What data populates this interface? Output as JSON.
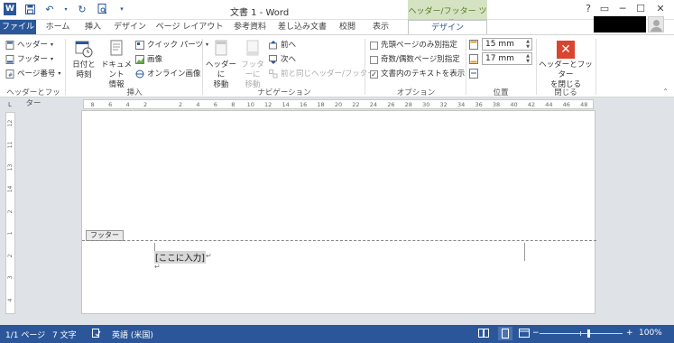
{
  "titlebar": {
    "doc_title": "文書 1 - Word",
    "contextual_tab_group": "ヘッダー/フッター ツール",
    "help_glyph": "?",
    "restore_glyph": "▭",
    "minimize_glyph": "─",
    "maximize_glyph": "☐",
    "close_glyph": "✕",
    "word_logo": "W"
  },
  "tabs": [
    {
      "label": "ファイル"
    },
    {
      "label": "ホーム"
    },
    {
      "label": "挿入"
    },
    {
      "label": "デザイン"
    },
    {
      "label": "ページ レイアウト"
    },
    {
      "label": "参考資料"
    },
    {
      "label": "差し込み文書"
    },
    {
      "label": "校閲"
    },
    {
      "label": "表示"
    },
    {
      "label": "デザイン"
    }
  ],
  "ribbon": {
    "hf_group": {
      "header": "ヘッダー",
      "footer": "フッター",
      "page_number": "ページ番号",
      "label": "ヘッダーとフッター"
    },
    "insert_group": {
      "datetime_l1": "日付と",
      "datetime_l2": "時刻",
      "docinfo_l1": "ドキュメント",
      "docinfo_l2": "情報",
      "quickparts": "クイック パーツ",
      "picture": "画像",
      "online_picture": "オンライン画像",
      "label": "挿入"
    },
    "nav_group": {
      "goto_header_l1": "ヘッダーに",
      "goto_header_l2": "移動",
      "goto_footer_l1": "フッターに",
      "goto_footer_l2": "移動",
      "prev": "前へ",
      "next": "次へ",
      "link_prev": "前と同じヘッダー/フッター",
      "label": "ナビゲーション"
    },
    "options_group": {
      "diff_first": "先頭ページのみ別指定",
      "diff_odd_even": "奇数/偶数ページ別指定",
      "show_text": "文書内のテキストを表示",
      "label": "オプション",
      "show_text_checked": true
    },
    "position_group": {
      "header_pos": "15 mm",
      "footer_pos": "17 mm",
      "label": "位置"
    },
    "close_group": {
      "close_l1": "ヘッダーとフッター",
      "close_l2": "を閉じる",
      "label": "閉じる"
    }
  },
  "ruler": {
    "corner": "L",
    "h_ticks": [
      "8",
      "6",
      "4",
      "2",
      "",
      "2",
      "4",
      "6",
      "8",
      "10",
      "12",
      "14",
      "16",
      "18",
      "20",
      "22",
      "24",
      "26",
      "28",
      "30",
      "32",
      "34",
      "36",
      "38",
      "40",
      "42",
      "44",
      "46",
      "48"
    ],
    "v_ticks": [
      "12",
      "11",
      "13",
      "14",
      "2",
      "1",
      "2",
      "3",
      "4"
    ]
  },
  "document": {
    "footer_tag": "フッター",
    "placeholder": "[ここに入力]",
    "pilcrow": "↵"
  },
  "status": {
    "page": "1/1 ページ",
    "words": "7 文字",
    "language": "英語 (米国)",
    "zoom": "100%",
    "zoom_level": 1.0,
    "minus": "−",
    "plus": "+"
  },
  "colors": {
    "word_blue": "#2b579a",
    "contextual_green": "#d6e3c3",
    "close_red": "#d9452f"
  }
}
